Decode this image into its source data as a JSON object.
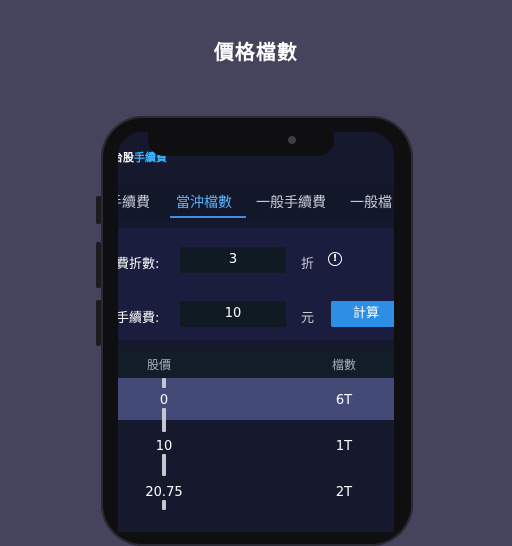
{
  "headline": "價格檔數",
  "app": {
    "title_prefix": "台股",
    "title_highlight": "手續費"
  },
  "tabs": [
    {
      "label": "手續費"
    },
    {
      "label": "當沖檔數",
      "active": true
    },
    {
      "label": "一般手續費"
    },
    {
      "label": "一般檔"
    }
  ],
  "form": {
    "discount": {
      "label": "費折數:",
      "value": "3",
      "unit": "折"
    },
    "fee": {
      "label": "手續費:",
      "value": "10",
      "unit": "元"
    },
    "calc_label": "計算"
  },
  "table": {
    "headers": {
      "price": "股價",
      "ticks": "檔數"
    },
    "rows": [
      {
        "price": "0",
        "ticks": "6T",
        "selected": true
      },
      {
        "price": "10",
        "ticks": "1T"
      },
      {
        "price": "20.75",
        "ticks": "2T"
      }
    ]
  },
  "colors": {
    "background": "#46445c",
    "accent": "#35b6ff",
    "button": "#2d8ee6",
    "selected_row": "#444a78"
  }
}
